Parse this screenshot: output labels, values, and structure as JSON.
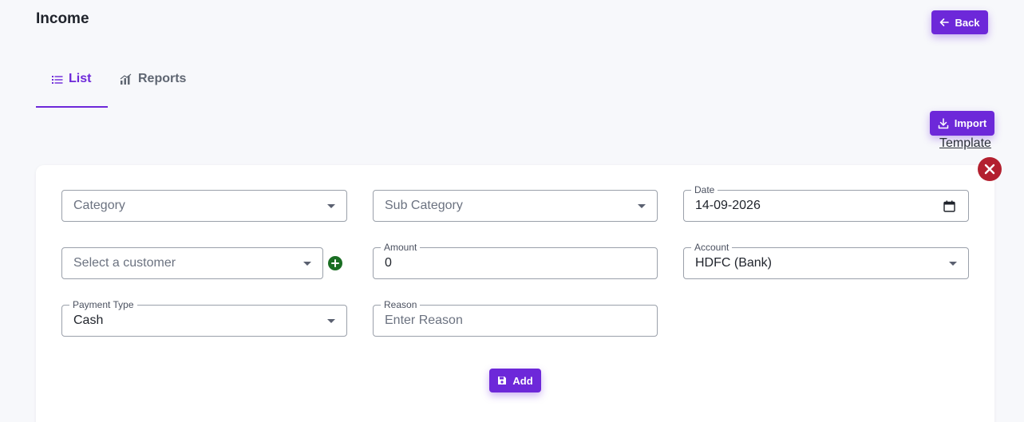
{
  "header": {
    "title": "Income",
    "back_label": "Back"
  },
  "tabs": [
    {
      "label": "List",
      "icon": "list-icon",
      "active": true
    },
    {
      "label": "Reports",
      "icon": "bar-chart-icon",
      "active": false
    }
  ],
  "actions": {
    "import_label": "Import",
    "template_label": "Template"
  },
  "form": {
    "category": {
      "placeholder": "Category"
    },
    "sub_category": {
      "placeholder": "Sub Category"
    },
    "date": {
      "label": "Date",
      "value": "14-09-2026"
    },
    "customer": {
      "placeholder": "Select a customer"
    },
    "amount": {
      "label": "Amount",
      "value": "0"
    },
    "account": {
      "label": "Account",
      "value": "HDFC (Bank)"
    },
    "payment_type": {
      "label": "Payment Type",
      "value": "Cash"
    },
    "reason": {
      "label": "Reason",
      "placeholder": "Enter Reason"
    },
    "add_label": "Add"
  },
  "colors": {
    "accent": "#6d28d9",
    "close": "#b3202f",
    "add_customer": "#1a6e23"
  }
}
